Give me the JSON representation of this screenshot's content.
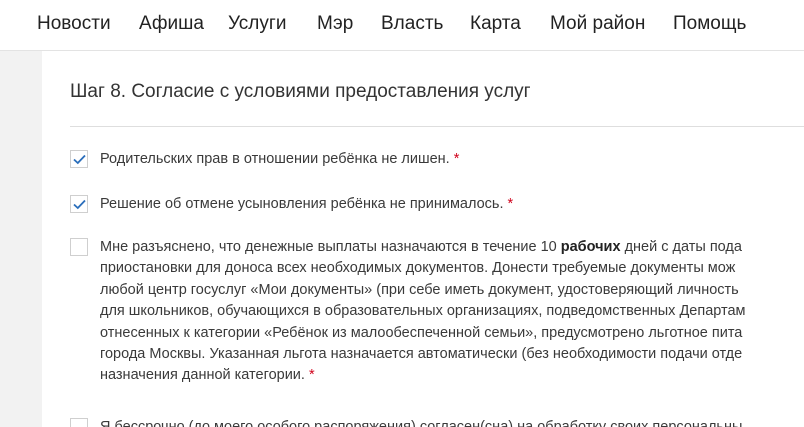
{
  "nav": {
    "items": [
      {
        "label": "Новости"
      },
      {
        "label": "Афиша"
      },
      {
        "label": "Услуги"
      },
      {
        "label": "Мэр"
      },
      {
        "label": "Власть"
      },
      {
        "label": "Карта"
      },
      {
        "label": "Мой район"
      },
      {
        "label": "Помощь"
      }
    ]
  },
  "step": {
    "title": "Шаг 8. Согласие с условиями предоставления услуг"
  },
  "colors": {
    "check_accent": "#2a6ebb",
    "required_mark": "#d0021b"
  },
  "consents": [
    {
      "checked": true,
      "text": "Родительских прав в отношении ребёнка не лишен.",
      "required": "*"
    },
    {
      "checked": true,
      "text": "Решение об отмене усыновления ребёнка не принималось.",
      "required": "*"
    },
    {
      "checked": false,
      "line1_pre": "Мне разъяснено, что денежные выплаты назначаются в течение 10",
      "line1_bold": "рабочих",
      "line1_post": "дней с даты пода",
      "lines": [
        "приостановки для доноса всех необходимых документов. Донести требуемые документы мож",
        "любой центр госуслуг «Мои документы» (при себе иметь документ, удостоверяющий личность",
        "для школьников, обучающихся в образовательных организациях, подведомственных Департам",
        "отнесенных к категории «Ребёнок из малообеспеченной семьи», предусмотрено льготное пита",
        "города Москвы. Указанная льгота назначается автоматически (без необходимости подачи отде"
      ],
      "last_line": "назначения данной категории.",
      "required": "*"
    },
    {
      "checked": false,
      "text": "Я бессрочно (до моего особого распоряжения) согласен(сна) на обработку своих персональны"
    }
  ]
}
